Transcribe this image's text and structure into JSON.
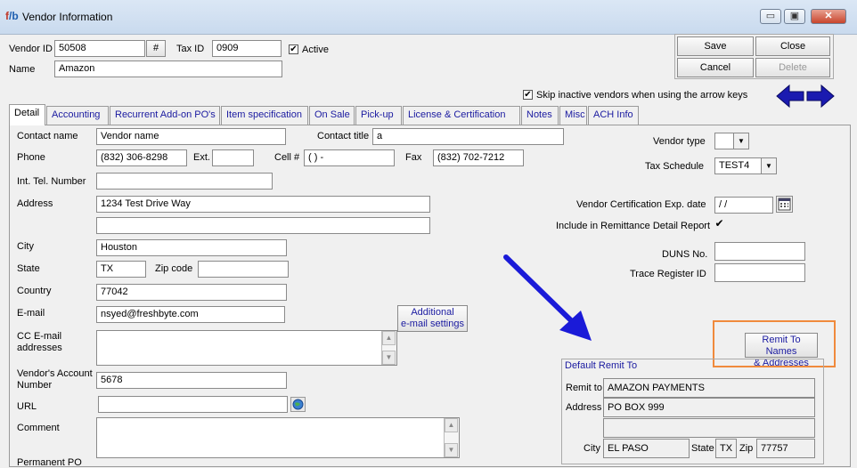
{
  "window": {
    "title": "Vendor Information",
    "minimize": "▭",
    "restore": "▣",
    "close": "✕"
  },
  "header": {
    "vendor_id_label": "Vendor ID",
    "vendor_id": "50508",
    "hash_button": "#",
    "tax_id_label": "Tax ID",
    "tax_id": "0909",
    "active_label": "Active",
    "active_checked": "✔",
    "name_label": "Name",
    "name": "Amazon",
    "skip_label": "Skip inactive vendors when using the arrow keys",
    "skip_checked": "✔"
  },
  "buttons": {
    "save": "Save",
    "close": "Close",
    "cancel": "Cancel",
    "delete": "Delete"
  },
  "tabs": [
    "Detail",
    "Accounting",
    "Recurrent Add-on PO's",
    "Item specification",
    "On Sale",
    "Pick-up",
    "License & Certification",
    "Notes",
    "Misc",
    "ACH Info"
  ],
  "detail": {
    "contact_name_label": "Contact name",
    "contact_name": "Vendor name",
    "contact_title_label": "Contact title",
    "contact_title": "a",
    "phone_label": "Phone",
    "phone": "(832) 306-8298",
    "ext_label": "Ext.",
    "ext": "",
    "cell_label": "Cell #",
    "cell": "(   )    -",
    "fax_label": "Fax",
    "fax": "(832) 702-7212",
    "int_tel_label": "Int. Tel. Number",
    "int_tel": "",
    "address_label": "Address",
    "address1": "1234 Test Drive Way",
    "address2": "",
    "city_label": "City",
    "city": "Houston",
    "state_label": "State",
    "state": "TX",
    "zip_label": "Zip code",
    "zip": "",
    "country_label": "Country",
    "country": "77042",
    "email_label": "E-mail",
    "email": "nsyed@freshbyte.com",
    "additional_email_button": "Additional\ne-mail settings",
    "cc_email_label": "CC E-mail\naddresses",
    "account_number_label": "Vendor's Account\nNumber",
    "account_number": "5678",
    "url_label": "URL",
    "url": "",
    "comment_label": "Comment",
    "permanent_po_label": "Permanent PO"
  },
  "right": {
    "vendor_type_label": "Vendor type",
    "vendor_type": "",
    "tax_schedule_label": "Tax Schedule",
    "tax_schedule": "TEST4",
    "cert_exp_label": "Vendor Certification Exp. date",
    "cert_exp": " /  / ",
    "remittance_label": "Include in Remittance Detail Report",
    "remittance_checked": "✔",
    "duns_label": "DUNS No.",
    "duns": "",
    "trace_label": "Trace Register ID",
    "trace": "",
    "remit_button": "Remit To Names\n& Addresses"
  },
  "remit": {
    "group_title": "Default Remit To",
    "remit_to_label": "Remit to",
    "remit_to": "AMAZON PAYMENTS",
    "address_label": "Address",
    "address1": "PO BOX 999",
    "address2": "",
    "city_label": "City",
    "city": "EL PASO",
    "state_label": "State",
    "state": "TX",
    "zip_label": "Zip",
    "zip": "77757"
  },
  "colors": {
    "annotation_arrow": "#1a1ad8",
    "highlight_box": "#f08a3c",
    "link_text": "#1a1aa0",
    "nav_arrows": "#1a1ab0"
  }
}
